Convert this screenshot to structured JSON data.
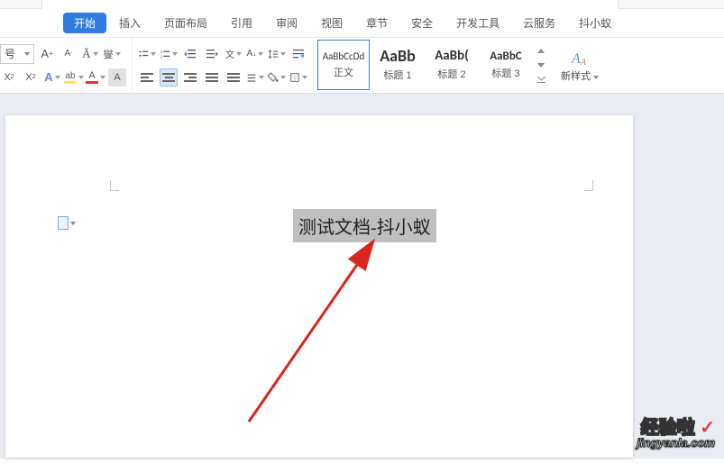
{
  "tabs": {
    "start": "开始",
    "insert": "插入",
    "layout": "页面布局",
    "reference": "引用",
    "review": "审阅",
    "view": "视图",
    "chapter": "章节",
    "security": "安全",
    "dev": "开发工具",
    "cloud": "云服务",
    "douxiaoyi": "抖小蚁"
  },
  "font": {
    "size_label": "号",
    "increase": "A⁺",
    "A_letter": "A",
    "X_letter": "X",
    "sub2": "2",
    "pinyin": "拼",
    "clearfmt_title": "清除格式"
  },
  "styles": {
    "preview_text": "AaBbCcDd",
    "preview_bold": "AaBb",
    "preview_h2": "AaBb(",
    "preview_h3": "AaBbC",
    "body": "正文",
    "h1": "标题 1",
    "h2": "标题 2",
    "h3": "标题 3",
    "new_style": "新样式"
  },
  "document": {
    "selected_text": "测试文档-抖小蚁"
  },
  "watermark": {
    "line1": "经验啦",
    "check": "✓",
    "line2": "jingyanla.com"
  }
}
